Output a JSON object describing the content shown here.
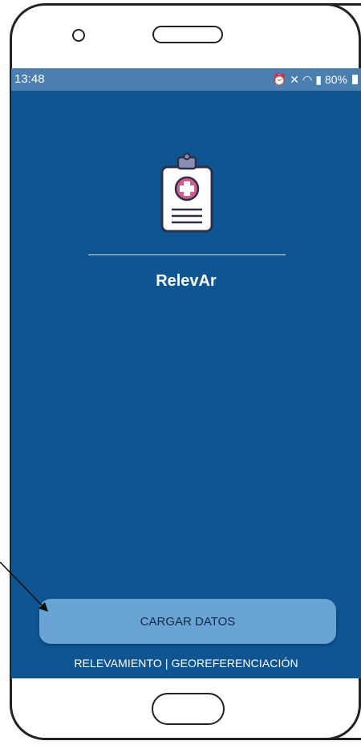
{
  "status_bar": {
    "time": "13:48",
    "battery": "80%",
    "icons": [
      "alarm-icon",
      "mute-icon",
      "wifi-icon",
      "signal-icon",
      "battery-icon"
    ]
  },
  "app": {
    "title": "RelevAr",
    "logo_icon": "clipboard-medical-icon"
  },
  "actions": {
    "load_button": "CARGAR DATOS"
  },
  "footer": {
    "text": "RELEVAMIENTO | GEOREFERENCIACIÓN"
  },
  "colors": {
    "screen_bg": "#0e5591",
    "status_bg": "#4a7fb0",
    "button_bg": "#6aa4d5",
    "accent_pink": "#d45b8e",
    "clipboard_border": "#2b2f4a"
  }
}
